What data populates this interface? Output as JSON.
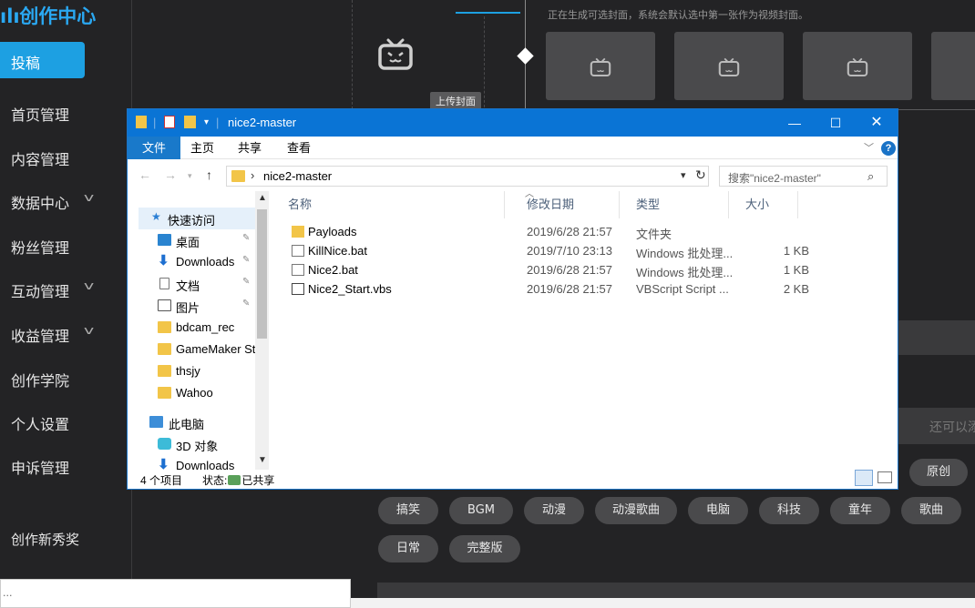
{
  "creator": {
    "brand": "创作中心",
    "upload_label": "投稿",
    "nav": [
      {
        "label": "首页管理"
      },
      {
        "label": "内容管理"
      },
      {
        "label": "数据中心",
        "expandable": true
      },
      {
        "label": "粉丝管理"
      },
      {
        "label": "互动管理",
        "expandable": true
      },
      {
        "label": "收益管理",
        "expandable": true
      },
      {
        "label": "创作学院"
      },
      {
        "label": "个人设置"
      },
      {
        "label": "申诉管理"
      }
    ],
    "award": "创作新秀奖",
    "top_note": "正在生成可选封面，系统会默认选中第一张作为视频封面。",
    "upload_cover": "上传封面",
    "more_hint": "还可以添",
    "original_tag": "原创",
    "tags_row1": [
      "搞笑",
      "BGM",
      "动漫",
      "动漫歌曲",
      "电脑",
      "科技",
      "童年",
      "歌曲"
    ],
    "tags_row2": [
      "日常",
      "完整版"
    ],
    "bottom_input": "..."
  },
  "explorer": {
    "title": "nice2-master",
    "ribbon_tabs": [
      "文件",
      "主页",
      "共享",
      "查看"
    ],
    "address": "nice2-master",
    "search_placeholder": "搜索\"nice2-master\"",
    "columns": [
      "名称",
      "修改日期",
      "类型",
      "大小"
    ],
    "nav_items": [
      {
        "label": "快速访问",
        "icon": "star-icon",
        "level": 0
      },
      {
        "label": "桌面",
        "icon": "desktop-icon",
        "pinned": true,
        "level": 1
      },
      {
        "label": "Downloads",
        "icon": "download-icon",
        "pinned": true,
        "level": 1
      },
      {
        "label": "文档",
        "icon": "document-icon",
        "pinned": true,
        "level": 1
      },
      {
        "label": "图片",
        "icon": "picture-icon",
        "pinned": true,
        "level": 1
      },
      {
        "label": "bdcam_rec",
        "icon": "folder-icon",
        "level": 1
      },
      {
        "label": "GameMaker St",
        "icon": "folder-icon",
        "level": 1
      },
      {
        "label": "thsjy",
        "icon": "folder-icon",
        "level": 1
      },
      {
        "label": "Wahoo",
        "icon": "folder-icon",
        "level": 1
      },
      {
        "label": "此电脑",
        "icon": "computer-icon",
        "level": 0
      },
      {
        "label": "3D 对象",
        "icon": "cube-icon",
        "level": 1
      },
      {
        "label": "Downloads",
        "icon": "download-icon",
        "level": 1
      }
    ],
    "files": [
      {
        "name": "Payloads",
        "date": "2019/6/28 21:57",
        "type": "文件夹",
        "size": "",
        "icon": "folder"
      },
      {
        "name": "KillNice.bat",
        "date": "2019/7/10 23:13",
        "type": "Windows 批处理...",
        "size": "1 KB",
        "icon": "bat"
      },
      {
        "name": "Nice2.bat",
        "date": "2019/6/28 21:57",
        "type": "Windows 批处理...",
        "size": "1 KB",
        "icon": "bat"
      },
      {
        "name": "Nice2_Start.vbs",
        "date": "2019/6/28 21:57",
        "type": "VBScript Script ...",
        "size": "2 KB",
        "icon": "vbs"
      }
    ],
    "status_count": "4 个项目",
    "status_share_prefix": "状态:",
    "status_share": "已共享"
  }
}
